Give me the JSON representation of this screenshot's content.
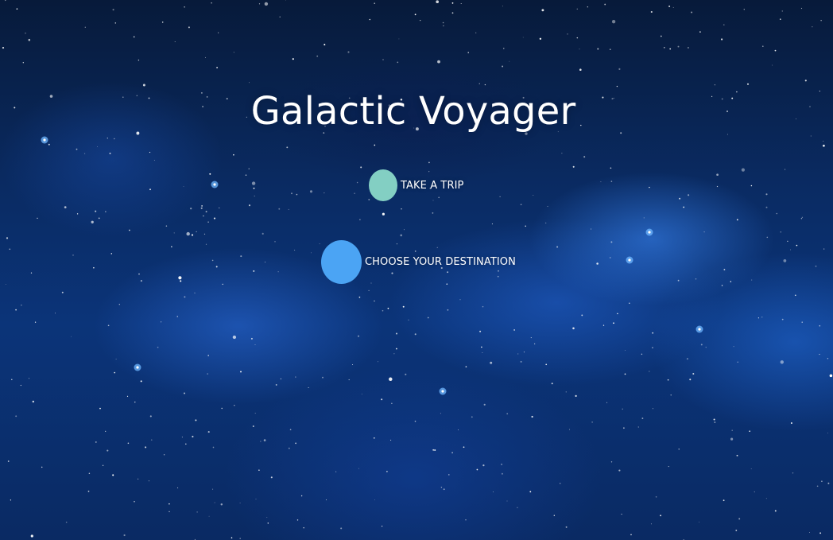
{
  "page": {
    "title": "Galactic Voyager"
  },
  "menu": {
    "items": [
      {
        "label": "TAKE A TRIP",
        "color": "#83cfc3"
      },
      {
        "label": "CHOOSE YOUR DESTINATION",
        "color": "#4ba4f4"
      }
    ]
  },
  "colors": {
    "background": "#0a2b63",
    "text": "#ffffff"
  }
}
